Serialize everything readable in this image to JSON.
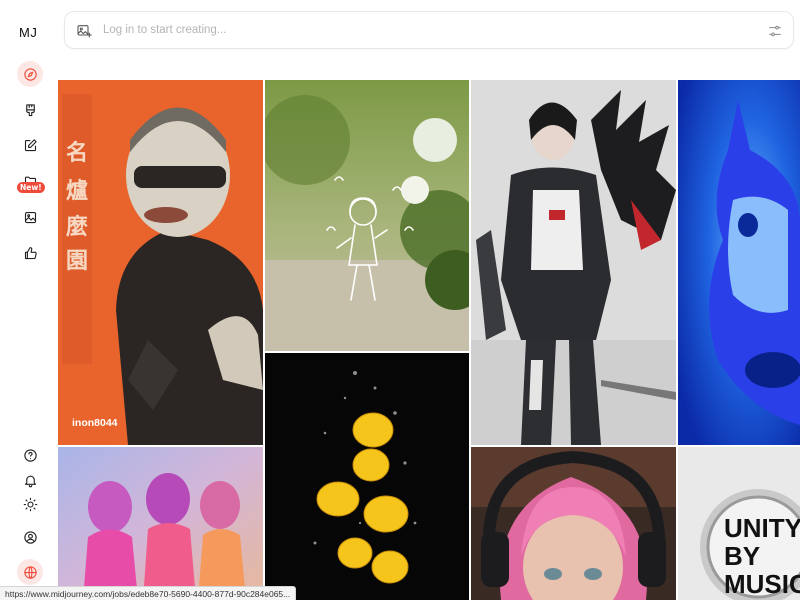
{
  "app": {
    "logo": "MJ"
  },
  "sidebar": {
    "badge_new": "New!",
    "items": [
      {
        "name": "explore",
        "icon": "compass-icon"
      },
      {
        "name": "create",
        "icon": "brush-icon"
      },
      {
        "name": "edit",
        "icon": "pencil-square-icon"
      },
      {
        "name": "organize",
        "icon": "folder-icon"
      },
      {
        "name": "personalize",
        "icon": "image-icon"
      },
      {
        "name": "rank",
        "icon": "thumbs-up-icon"
      }
    ],
    "bottom_items": [
      {
        "name": "help",
        "icon": "question-circle-icon"
      },
      {
        "name": "notifications",
        "icon": "bell-icon"
      },
      {
        "name": "theme",
        "icon": "sun-icon"
      },
      {
        "name": "account",
        "icon": "user-circle-icon"
      },
      {
        "name": "language",
        "icon": "globe-icon"
      }
    ]
  },
  "search": {
    "placeholder": "Log in to start creating..."
  },
  "gallery": {
    "tiles": [
      {
        "subject": "poster-runner",
        "caption": "inon8044"
      },
      {
        "subject": "doodle-girl-music"
      },
      {
        "subject": "mecha-dragon-warrior"
      },
      {
        "subject": "blue-horse-silhouette"
      },
      {
        "subject": "pastel-women-trio"
      },
      {
        "subject": "lemons-in-water"
      },
      {
        "subject": "pink-hair-headphones"
      },
      {
        "subject": "unity-by-music"
      }
    ],
    "poster_text": "UNITY BY MUSIC"
  },
  "statusbar": {
    "url": "https://www.midjourney.com/jobs/edeb8e70-5690-4400-877d-90c284e065..."
  },
  "colors": {
    "accent": "#ef4b3a",
    "accent_bg": "#fde7e4"
  }
}
